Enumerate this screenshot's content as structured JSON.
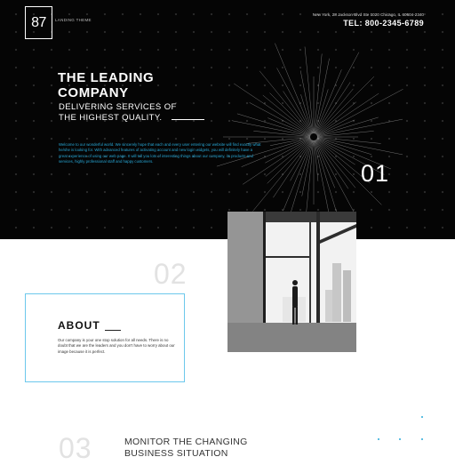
{
  "header": {
    "logo": "87",
    "tagline": "LANDING THEME",
    "address": "New York, 28 Jackson Blvd Ste 1020 Chicago, IL 60604-2340",
    "phone": "TEL: 800-2345-6789"
  },
  "hero": {
    "title_line1": "THE LEADING",
    "title_line2": "COMPANY",
    "subtitle_line1": "DELIVERING SERVICES OF",
    "subtitle_line2": "THE HIGHEST QUALITY.",
    "text": "Welcome to our wonderful world. We sincerely hope that each and every user entering our website will find exactly what he/she is looking for. With advanced features of activating account and new login widgets, you will definitely have a great experience of using our web page. It will tell you lots of interesting things about our company, its products and services, highly professional staff and happy customers.",
    "number": "01"
  },
  "about": {
    "number": "02",
    "title": "ABOUT",
    "text": "Our company is your one stop solution for all needs. There is no doubt that we are the leaders and you don't have to worry about our image because it is perfect."
  },
  "section3": {
    "number": "03",
    "title_line1": "MONITOR THE CHANGING",
    "title_line2": "BUSINESS SITUATION"
  },
  "colors": {
    "accent": "#28a9d8",
    "hero_background": "#050505",
    "box_border": "#6cc8ec"
  },
  "icons": {
    "hero_decoration": "starburst-lines",
    "section_dots": "dot-grid"
  }
}
